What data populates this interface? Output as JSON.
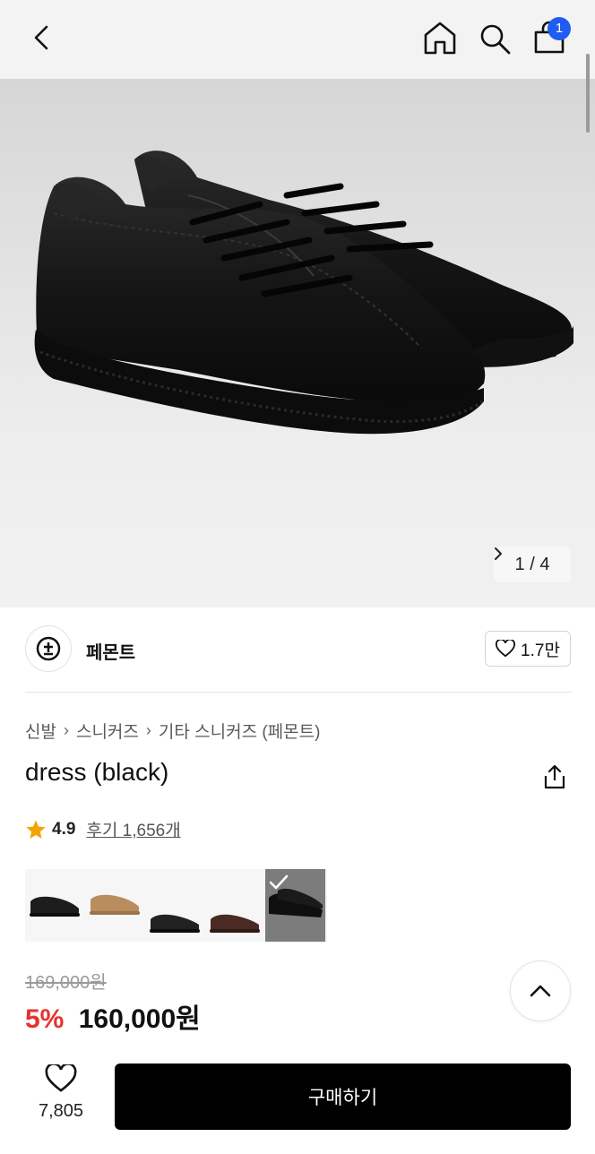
{
  "header": {
    "cart_count": "1",
    "icons": [
      "back-icon",
      "home-icon",
      "search-icon",
      "cart-icon"
    ]
  },
  "gallery": {
    "counter_current": "1",
    "counter_separator": "/",
    "counter_total": "4"
  },
  "brand": {
    "name": "페몬트",
    "like_count": "1.7만"
  },
  "breadcrumb": [
    "신발",
    "스니커즈",
    "기타 스니커즈 (페몬트)"
  ],
  "product": {
    "title": "dress (black)",
    "rating": "4.9",
    "reviews_label": "후기 1,656개",
    "original_price": "169,000원",
    "discount": "5%",
    "price": "160,000원"
  },
  "color_options": [
    "black suede",
    "tan suede",
    "black leather",
    "brown suede",
    "black (selected)"
  ],
  "bottom_bar": {
    "like_count": "7,805",
    "buy_label": "구매하기"
  },
  "colors": {
    "accent_red": "#e5322d",
    "badge_blue": "#1f5cf2",
    "buy_button": "#000000"
  }
}
